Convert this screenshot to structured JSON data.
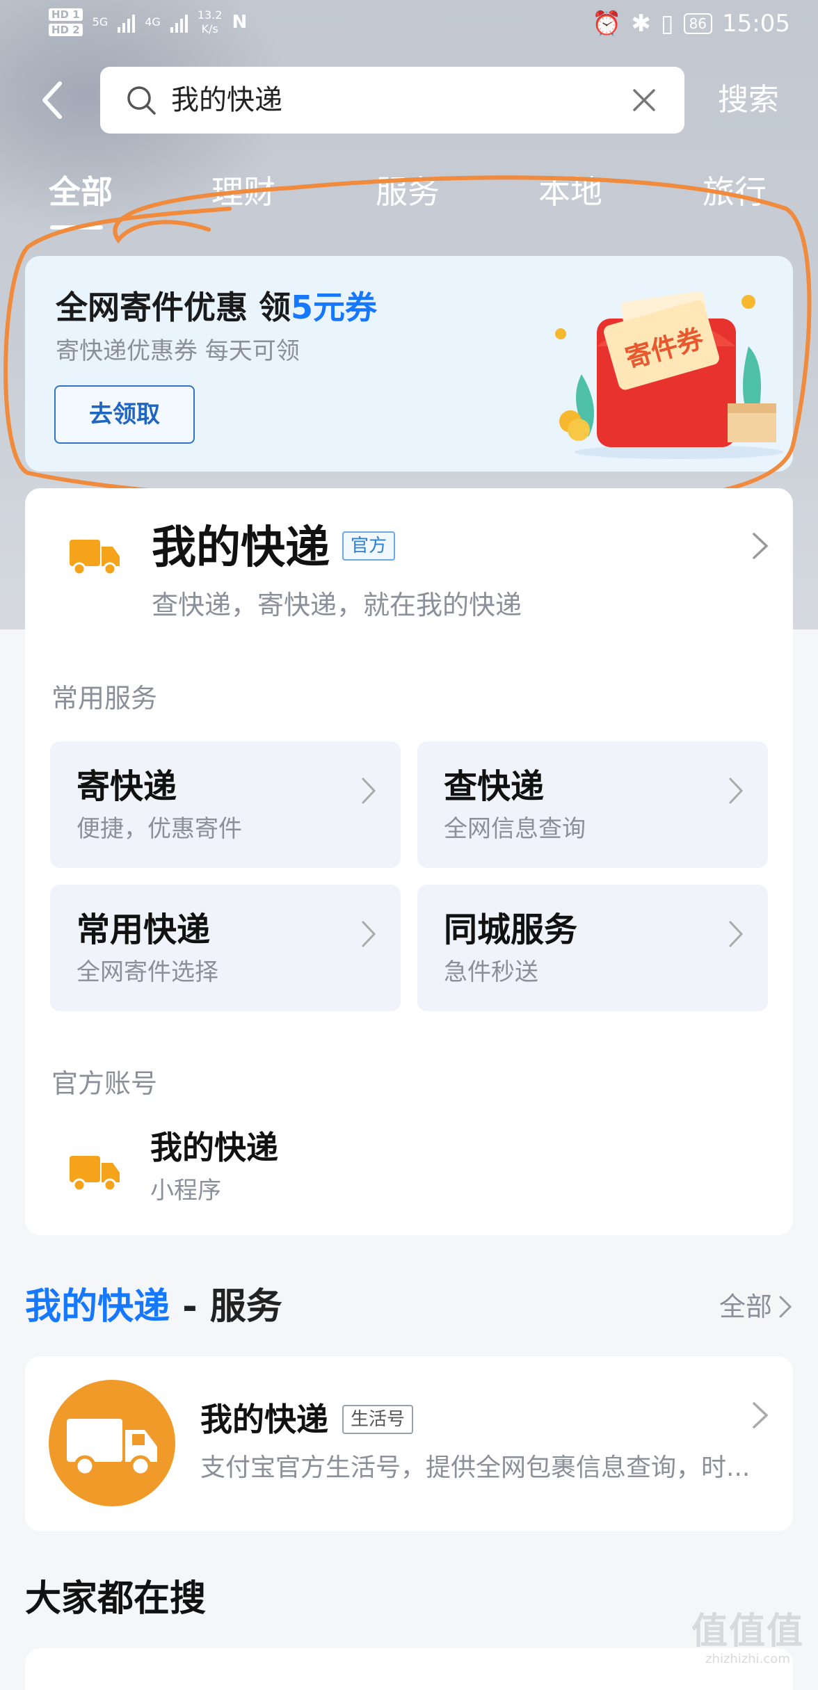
{
  "status_bar": {
    "hd1": "HD 1",
    "hd2": "HD 2",
    "net_a": "5G",
    "net_b": "4G",
    "speed": "13.2",
    "speed_unit": "K/s",
    "nfc": "N",
    "battery": "86",
    "time": "15:05"
  },
  "search": {
    "query": "我的快递",
    "submit_label": "搜索"
  },
  "tabs": [
    "全部",
    "理财",
    "服务",
    "本地",
    "旅行"
  ],
  "active_tab": 0,
  "promo": {
    "title_prefix": "全网寄件优惠 领",
    "title_highlight": "5元券",
    "subtitle": "寄快递优惠券 每天可领",
    "button": "去领取",
    "art_text": "寄件券"
  },
  "main_card": {
    "title": "我的快递",
    "tag": "官方",
    "subtitle": "查快递，寄快递，就在我的快递",
    "services_label": "常用服务",
    "services": [
      {
        "title": "寄快递",
        "subtitle": "便捷，优惠寄件"
      },
      {
        "title": "查快递",
        "subtitle": "全网信息查询"
      },
      {
        "title": "常用快递",
        "subtitle": "全网寄件选择"
      },
      {
        "title": "同城服务",
        "subtitle": "急件秒送"
      }
    ],
    "account_label": "官方账号",
    "account": {
      "title": "我的快递",
      "subtitle": "小程序"
    }
  },
  "service_section": {
    "title_blue": "我的快递",
    "title_rest": " - 服务",
    "all_label": "全部"
  },
  "life_card": {
    "title": "我的快递",
    "tag": "生活号",
    "subtitle": "支付宝官方生活号，提供全网包裹信息查询，时..."
  },
  "hot_search_title": "大家都在搜",
  "watermark": {
    "big": "值值值",
    "small": "zhizhizhi.com"
  },
  "colors": {
    "accent_blue": "#1677ff",
    "brand_orange": "#f09a2a",
    "annotation_orange": "#f08a3c"
  }
}
